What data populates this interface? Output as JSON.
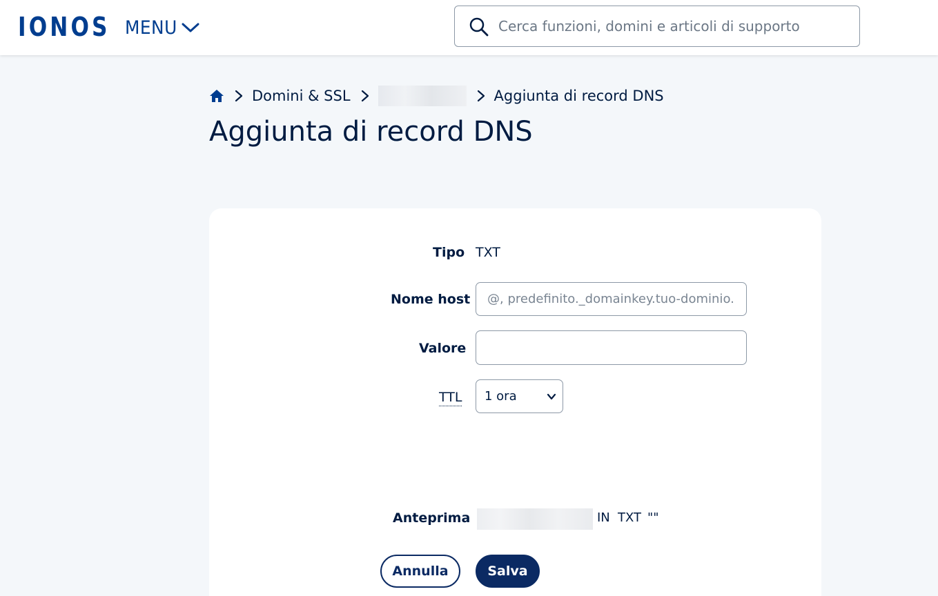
{
  "header": {
    "logo": "IONOS",
    "menu_label": "MENU",
    "search_placeholder": "Cerca funzioni, domini e articoli di supporto"
  },
  "breadcrumb": {
    "items": [
      "Domini & SSL",
      "Aggiunta di record DNS"
    ]
  },
  "page": {
    "title": "Aggiunta di record DNS"
  },
  "form": {
    "tipo_label": "Tipo",
    "tipo_value": "TXT",
    "host_label": "Nome host",
    "host_placeholder": "@, predefinito._domainkey.tuo-dominio.",
    "host_value": "",
    "valore_label": "Valore",
    "valore_value": "",
    "ttl_label": "TTL",
    "ttl_value": "1 ora",
    "preview_label": "Anteprima",
    "preview_class": "IN",
    "preview_type": "TXT",
    "preview_value": "\"\""
  },
  "actions": {
    "cancel_label": "Annulla",
    "save_label": "Salva"
  },
  "colors": {
    "brand": "#003d8f",
    "primary_button": "#0b2a63",
    "page_background": "#f4f7fa"
  }
}
